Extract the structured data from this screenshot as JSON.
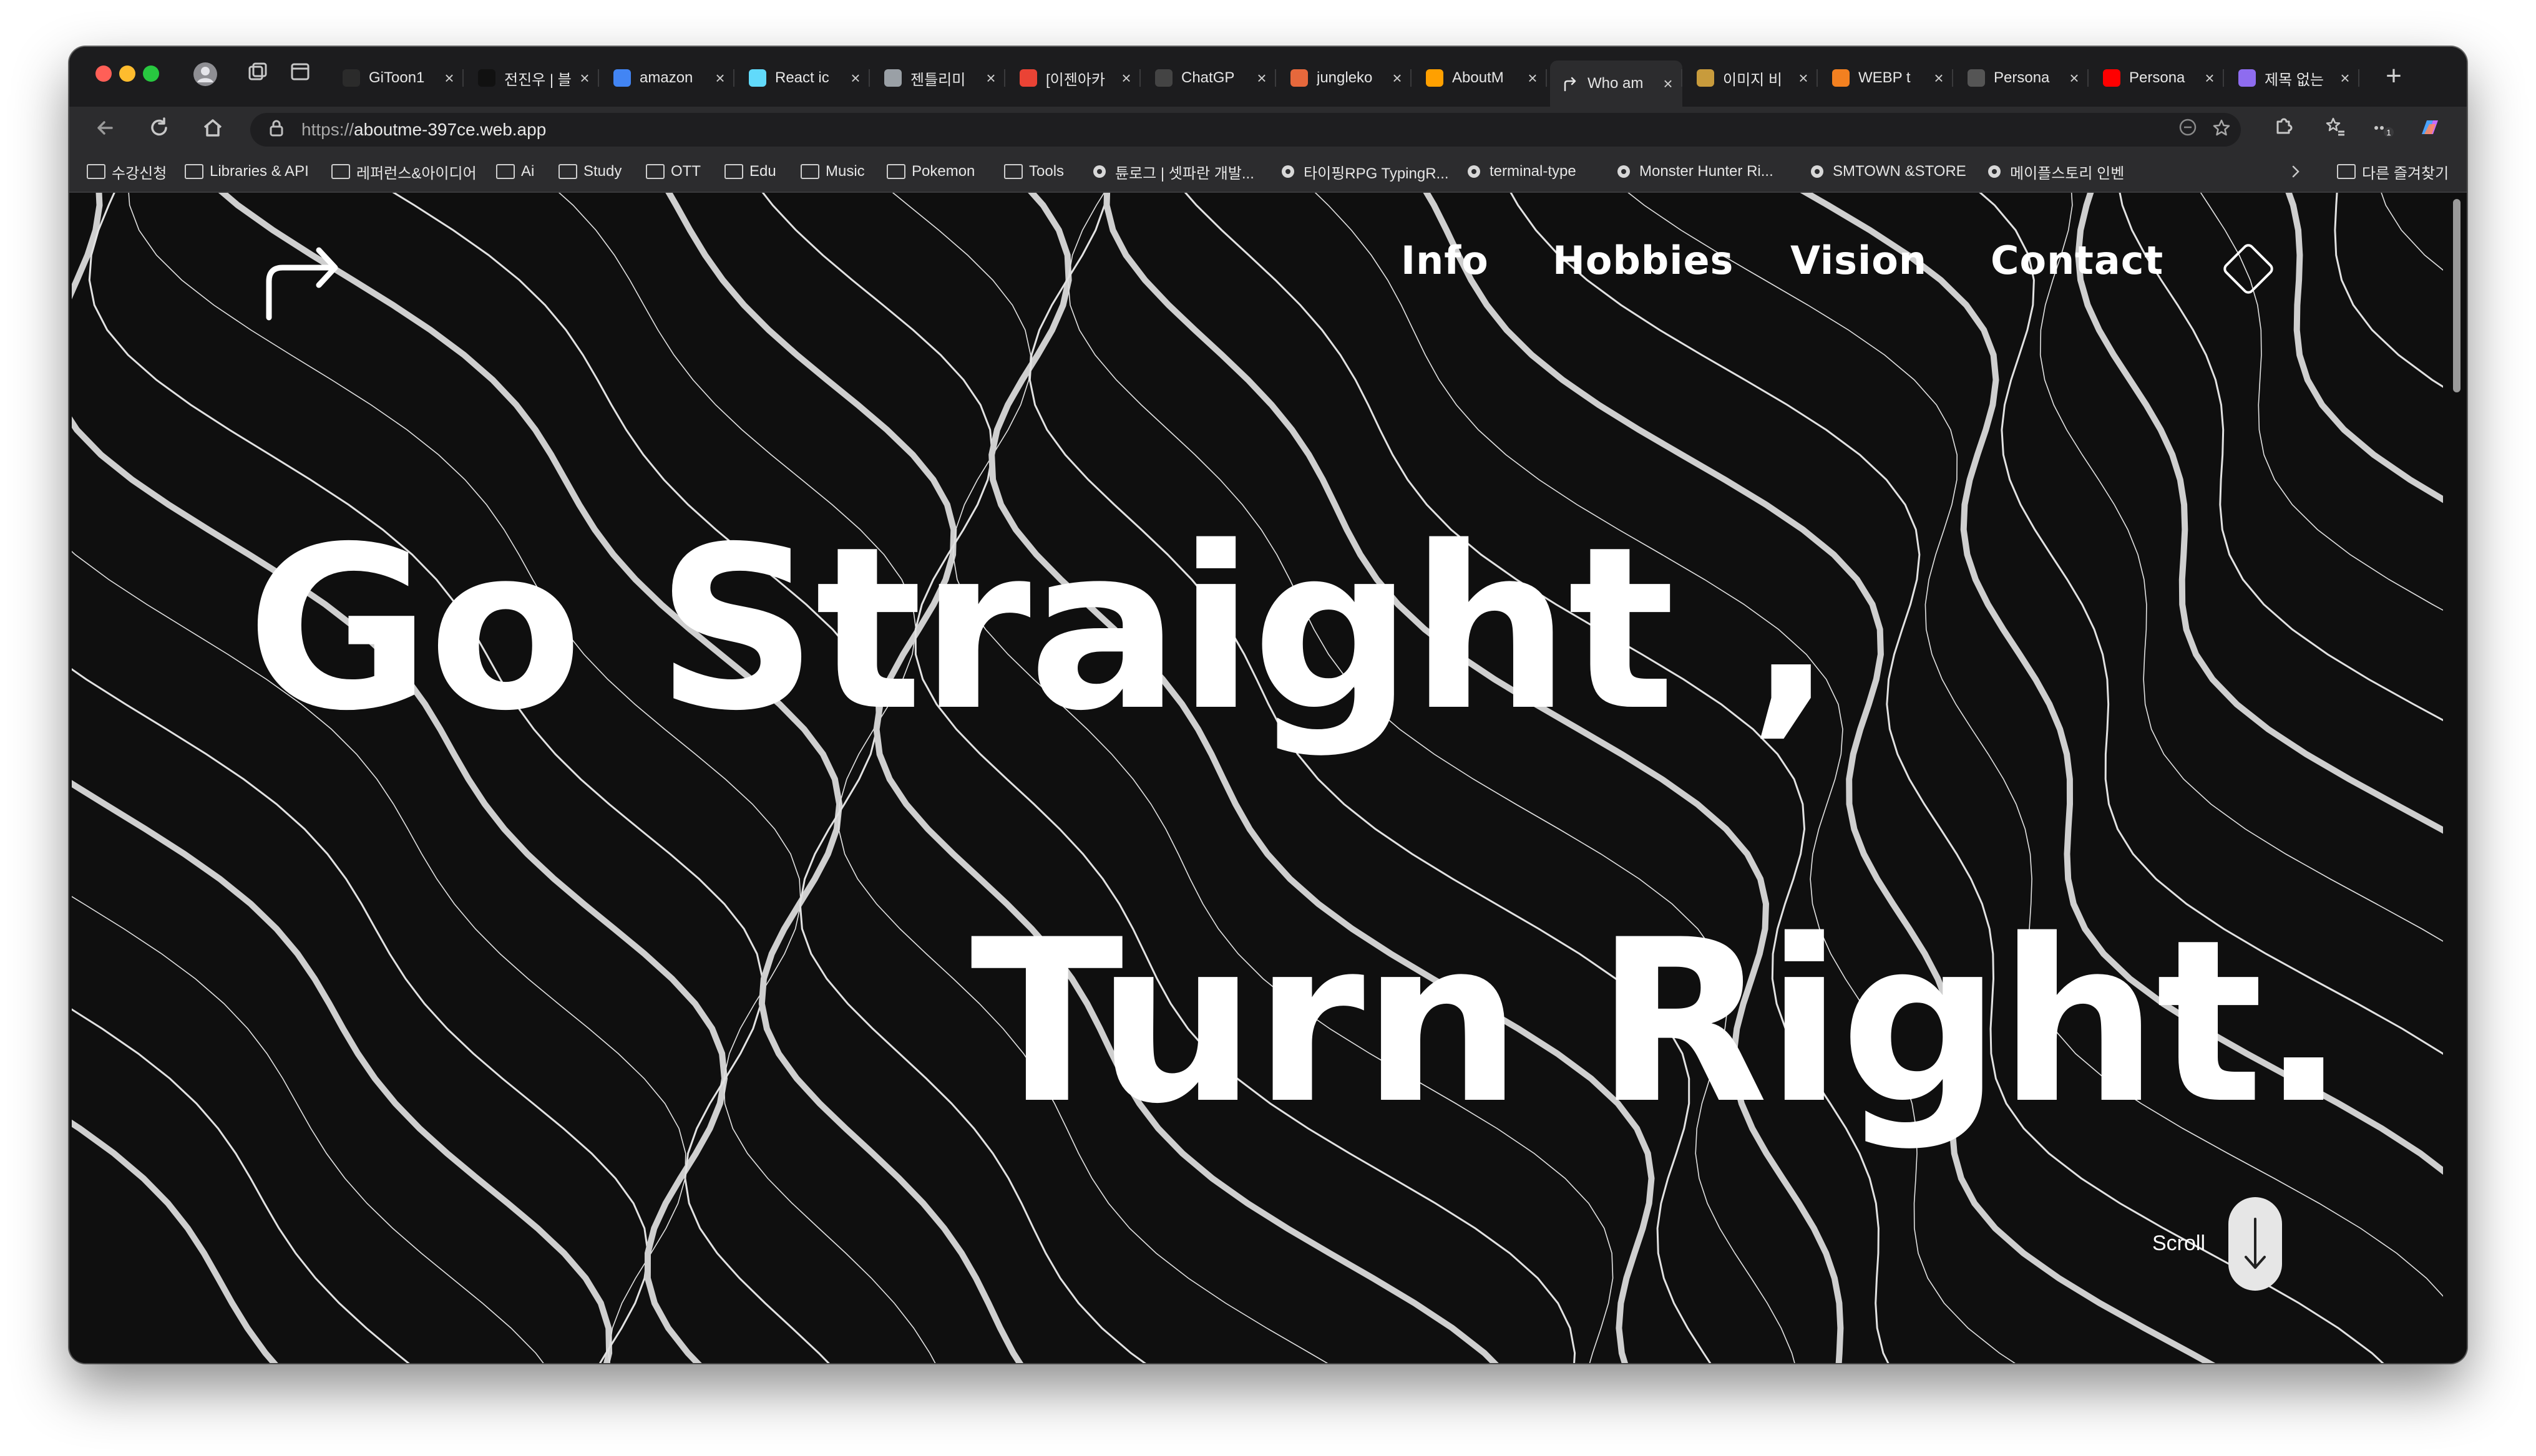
{
  "browser": {
    "tabs": [
      {
        "title": "GiToon1",
        "icon": "github-icon"
      },
      {
        "title": "전진우 | 블",
        "icon": "dark-square-icon"
      },
      {
        "title": "amazon",
        "icon": "google-icon"
      },
      {
        "title": "React ic",
        "icon": "react-icon"
      },
      {
        "title": "젠틀리미",
        "icon": "google-icon"
      },
      {
        "title": "[이젠아카",
        "icon": "gmail-icon"
      },
      {
        "title": "ChatGP",
        "icon": "chatgpt-icon"
      },
      {
        "title": "jungleko",
        "icon": "jungle-icon"
      },
      {
        "title": "AboutM",
        "icon": "firebase-icon"
      },
      {
        "title": "Who am",
        "icon": "arrow-icon"
      },
      {
        "title": "이미지 비",
        "icon": "image-icon"
      },
      {
        "title": "WEBP t",
        "icon": "cloud-icon"
      },
      {
        "title": "Persona",
        "icon": "pen-icon"
      },
      {
        "title": "Persona",
        "icon": "youtube-icon"
      },
      {
        "title": "제목 없는",
        "icon": "drive-icon"
      }
    ],
    "active_tab_index": 9,
    "url_scheme": "https://",
    "url_host": "aboutme-397ce.web.app",
    "bookmarks": [
      {
        "label": "수강신청",
        "icon": "folder-icon"
      },
      {
        "label": "Libraries & API",
        "icon": "folder-icon"
      },
      {
        "label": "레퍼런스&아이디어",
        "icon": "folder-icon"
      },
      {
        "label": "Ai",
        "icon": "folder-icon"
      },
      {
        "label": "Study",
        "icon": "folder-icon"
      },
      {
        "label": "OTT",
        "icon": "folder-icon"
      },
      {
        "label": "Edu",
        "icon": "folder-icon"
      },
      {
        "label": "Music",
        "icon": "folder-icon"
      },
      {
        "label": "Pokemon",
        "icon": "folder-icon"
      },
      {
        "label": "Tools",
        "icon": "folder-icon"
      },
      {
        "label": "튠로그 | 셋파란 개발...",
        "icon": "site-icon"
      },
      {
        "label": "타이핑RPG TypingR...",
        "icon": "sword-icon"
      },
      {
        "label": "terminal-type",
        "icon": "terminal-icon"
      },
      {
        "label": "Monster Hunter Ri...",
        "icon": "monster-icon"
      },
      {
        "label": "SMTOWN &STORE",
        "icon": "store-icon"
      },
      {
        "label": "메이플스토리 인벤",
        "icon": "inven-icon"
      }
    ],
    "other_bookmarks": "다른 즐겨찾기"
  },
  "site": {
    "nav": [
      "Info",
      "Hobbies",
      "Vision",
      "Contact"
    ],
    "hero_line1": "Go Straight ,",
    "hero_line2": "Turn Right.",
    "scroll_label": "Scroll",
    "colors": {
      "background": "#0f0f0f",
      "text": "#ffffff",
      "contour": "#d8d8d8"
    }
  }
}
